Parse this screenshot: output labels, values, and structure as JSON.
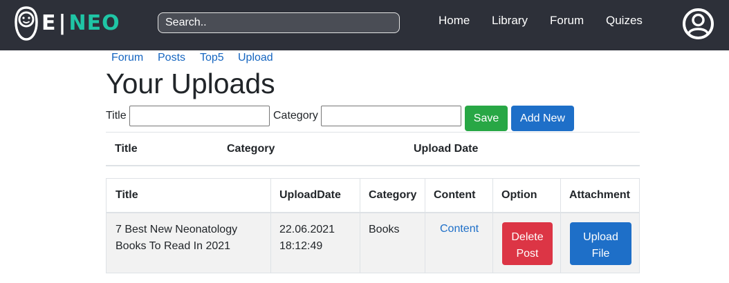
{
  "brand": {
    "letter": "E",
    "separator": "|",
    "name": "NEO",
    "colors": {
      "navbar": "#2d3039",
      "accent": "#1fc5a5"
    }
  },
  "search": {
    "placeholder": "Search.."
  },
  "nav": {
    "home": "Home",
    "library": "Library",
    "forum": "Forum",
    "quizes": "Quizes"
  },
  "user_icon": "user-circle-icon",
  "subnav": {
    "forum": "Forum",
    "posts": "Posts",
    "top5": "Top5",
    "upload": "Upload"
  },
  "page": {
    "title": "Your Uploads"
  },
  "form": {
    "title_label": "Title",
    "title_value": "",
    "category_label": "Category",
    "category_value": "",
    "save_label": "Save",
    "add_new_label": "Add New"
  },
  "summary_table": {
    "headers": [
      "Title",
      "Category",
      "Upload Date"
    ]
  },
  "uploads_table": {
    "headers": [
      "Title",
      "UploadDate",
      "Category",
      "Content",
      "Option",
      "Attachment"
    ],
    "rows": [
      {
        "title_line1": "7 Best New Neonatology",
        "title_line2": "Books To Read In 2021",
        "date": "22.06.2021",
        "time": "18:12:49",
        "category": "Books",
        "content_link": "Content",
        "option_line1": "Delete",
        "option_line2": "Post",
        "attachment_line1": "Upload",
        "attachment_line2": "File"
      }
    ]
  }
}
